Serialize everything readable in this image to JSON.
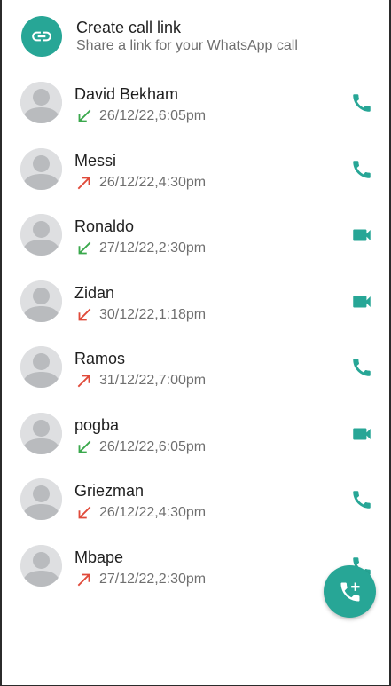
{
  "colors": {
    "accent": "#27a696",
    "incoming": "#3aa84c",
    "outgoing": "#e04a3a",
    "avatar_bg": "#dedfe1",
    "avatar_fg": "#b9bbbe"
  },
  "create_link": {
    "icon": "link-icon",
    "title": "Create call link",
    "subtitle": "Share a link for your WhatsApp call"
  },
  "calls": [
    {
      "name": "David Bekham",
      "time": "26/12/22,6:05pm",
      "direction": "incoming",
      "type": "voice"
    },
    {
      "name": "Messi",
      "time": "26/12/22,4:30pm",
      "direction": "outgoing",
      "type": "voice"
    },
    {
      "name": "Ronaldo",
      "time": "27/12/22,2:30pm",
      "direction": "incoming",
      "type": "video"
    },
    {
      "name": "Zidan",
      "time": "30/12/22,1:18pm",
      "direction": "missed",
      "type": "video"
    },
    {
      "name": "Ramos",
      "time": "31/12/22,7:00pm",
      "direction": "outgoing",
      "type": "voice"
    },
    {
      "name": "pogba",
      "time": "26/12/22,6:05pm",
      "direction": "incoming",
      "type": "video"
    },
    {
      "name": "Griezman",
      "time": "26/12/22,4:30pm",
      "direction": "missed",
      "type": "voice"
    },
    {
      "name": "Mbape",
      "time": "27/12/22,2:30pm",
      "direction": "outgoing",
      "type": "voice"
    }
  ],
  "fab": {
    "icon": "add-call-icon"
  }
}
